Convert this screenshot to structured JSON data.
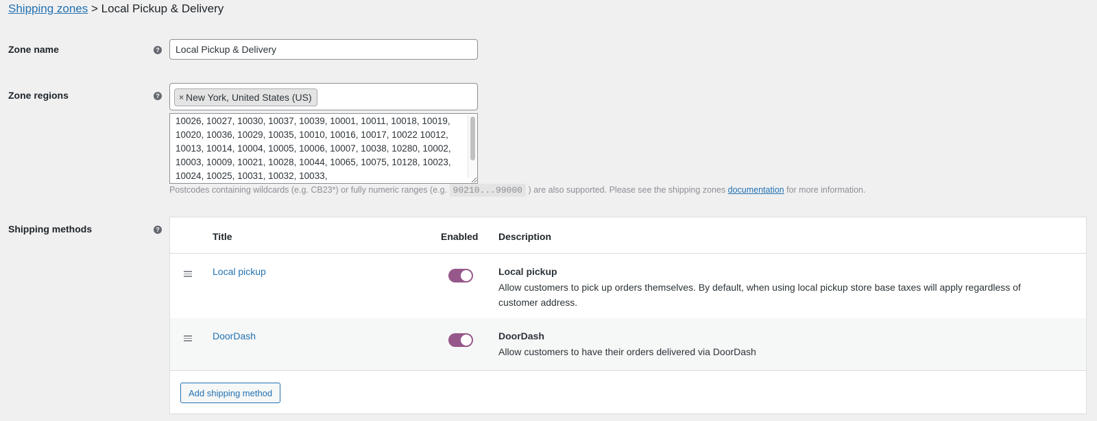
{
  "breadcrumb": {
    "parent_link": "Shipping zones",
    "separator": ">",
    "current": "Local Pickup & Delivery"
  },
  "zone_name": {
    "label": "Zone name",
    "value": "Local Pickup & Delivery",
    "help_icon": "question-icon"
  },
  "zone_regions": {
    "label": "Zone regions",
    "help_icon": "question-icon",
    "selected": [
      {
        "remove_glyph": "×",
        "label": "New York, United States (US)"
      }
    ],
    "postcodes": "10026, 10027, 10030, 10037, 10039, 10001, 10011, 10018, 10019, 10020, 10036, 10029, 10035, 10010, 10016, 10017, 10022 10012, 10013, 10014, 10004, 10005, 10006, 10007, 10038, 10280, 10002, 10003, 10009, 10021, 10028, 10044, 10065, 10075, 10128, 10023, 10024, 10025, 10031, 10032, 10033,",
    "hint_before": "Postcodes containing wildcards (e.g. CB23*) or fully numeric ranges (e.g.",
    "hint_code": "90210...99000",
    "hint_middle": ") are also supported. Please see the shipping zones",
    "hint_link": "documentation",
    "hint_after": "for more information."
  },
  "shipping_methods": {
    "label": "Shipping methods",
    "help_icon": "question-icon",
    "columns": {
      "title": "Title",
      "enabled": "Enabled",
      "description": "Description"
    },
    "rows": [
      {
        "title": "Local pickup",
        "enabled": true,
        "desc_title": "Local pickup",
        "desc_text": "Allow customers to pick up orders themselves. By default, when using local pickup store base taxes will apply regardless of customer address."
      },
      {
        "title": "DoorDash",
        "enabled": true,
        "desc_title": "DoorDash",
        "desc_text": "Allow customers to have their orders delivered via DoorDash"
      }
    ],
    "add_button": "Add shipping method"
  },
  "colors": {
    "link": "#2271b1",
    "toggle_on": "#96588a",
    "background": "#f0f0f1"
  }
}
